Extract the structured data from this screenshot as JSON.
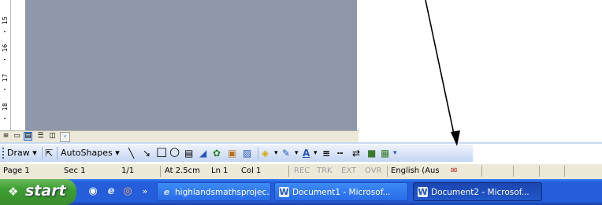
{
  "ruler": {
    "numbers": [
      "15",
      "16",
      "17",
      "18"
    ]
  },
  "view_buttons": [
    "normal-view",
    "web-layout-view",
    "print-layout-view",
    "outline-view",
    "reading-layout-view"
  ],
  "drawing_toolbar": {
    "draw_label": "Draw",
    "autoshapes_label": "AutoShapes"
  },
  "status_bar": {
    "page": "Page 1",
    "section": "Sec 1",
    "pages": "1/1",
    "at": "At 2.5cm",
    "line": "Ln 1",
    "col": "Col 1",
    "rec": "REC",
    "trk": "TRK",
    "ext": "EXT",
    "ovr": "OVR",
    "language": "English (Aus"
  },
  "taskbar": {
    "start_label": "start",
    "overflow": "»",
    "tasks": [
      {
        "label": "highlandsmathsprojec...",
        "icon": "ie-icon"
      },
      {
        "label": "Document1 - Microsof...",
        "icon": "word-icon"
      },
      {
        "label": "Document2 - Microsof...",
        "icon": "word-icon"
      }
    ]
  },
  "colors": {
    "page_gray": "#8f97ab",
    "taskbar_blue": "#245edb",
    "start_green": "#3c9e30",
    "toolbar_blue": "#c4d6f3"
  }
}
